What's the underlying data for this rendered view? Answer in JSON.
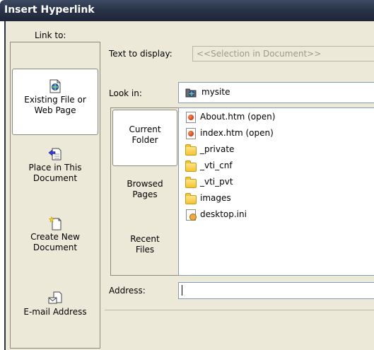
{
  "window": {
    "title": "Insert Hyperlink"
  },
  "link_to": {
    "label": "Link to:",
    "items": [
      {
        "line1": "Existing File or",
        "line2": "Web Page",
        "icon": "existing-file-icon",
        "selected": true
      },
      {
        "line1": "Place in This",
        "line2": "Document",
        "icon": "place-in-document-icon",
        "selected": false
      },
      {
        "line1": "Create New",
        "line2": "Document",
        "icon": "create-new-document-icon",
        "selected": false
      },
      {
        "line1": "E-mail Address",
        "line2": "",
        "icon": "email-address-icon",
        "selected": false
      }
    ]
  },
  "text_to_display": {
    "label": "Text to display:",
    "value": "<<Selection in Document>>"
  },
  "look_in": {
    "label": "Look in:",
    "value": "mysite",
    "icon": "web-folder-icon"
  },
  "browse_tabs": [
    {
      "line1": "Current",
      "line2": "Folder",
      "selected": true
    },
    {
      "line1": "Browsed",
      "line2": "Pages",
      "selected": false
    },
    {
      "line1": "Recent",
      "line2": "Files",
      "selected": false
    }
  ],
  "files": [
    {
      "name": "About.htm (open)",
      "icon": "html-file-icon"
    },
    {
      "name": "index.htm (open)",
      "icon": "html-file-icon"
    },
    {
      "name": "_private",
      "icon": "folder-icon"
    },
    {
      "name": "_vti_cnf",
      "icon": "folder-icon"
    },
    {
      "name": "_vti_pvt",
      "icon": "folder-icon"
    },
    {
      "name": "images",
      "icon": "folder-icon"
    },
    {
      "name": "desktop.ini",
      "icon": "ini-file-icon"
    }
  ],
  "address": {
    "label": "Address:",
    "value": ""
  }
}
